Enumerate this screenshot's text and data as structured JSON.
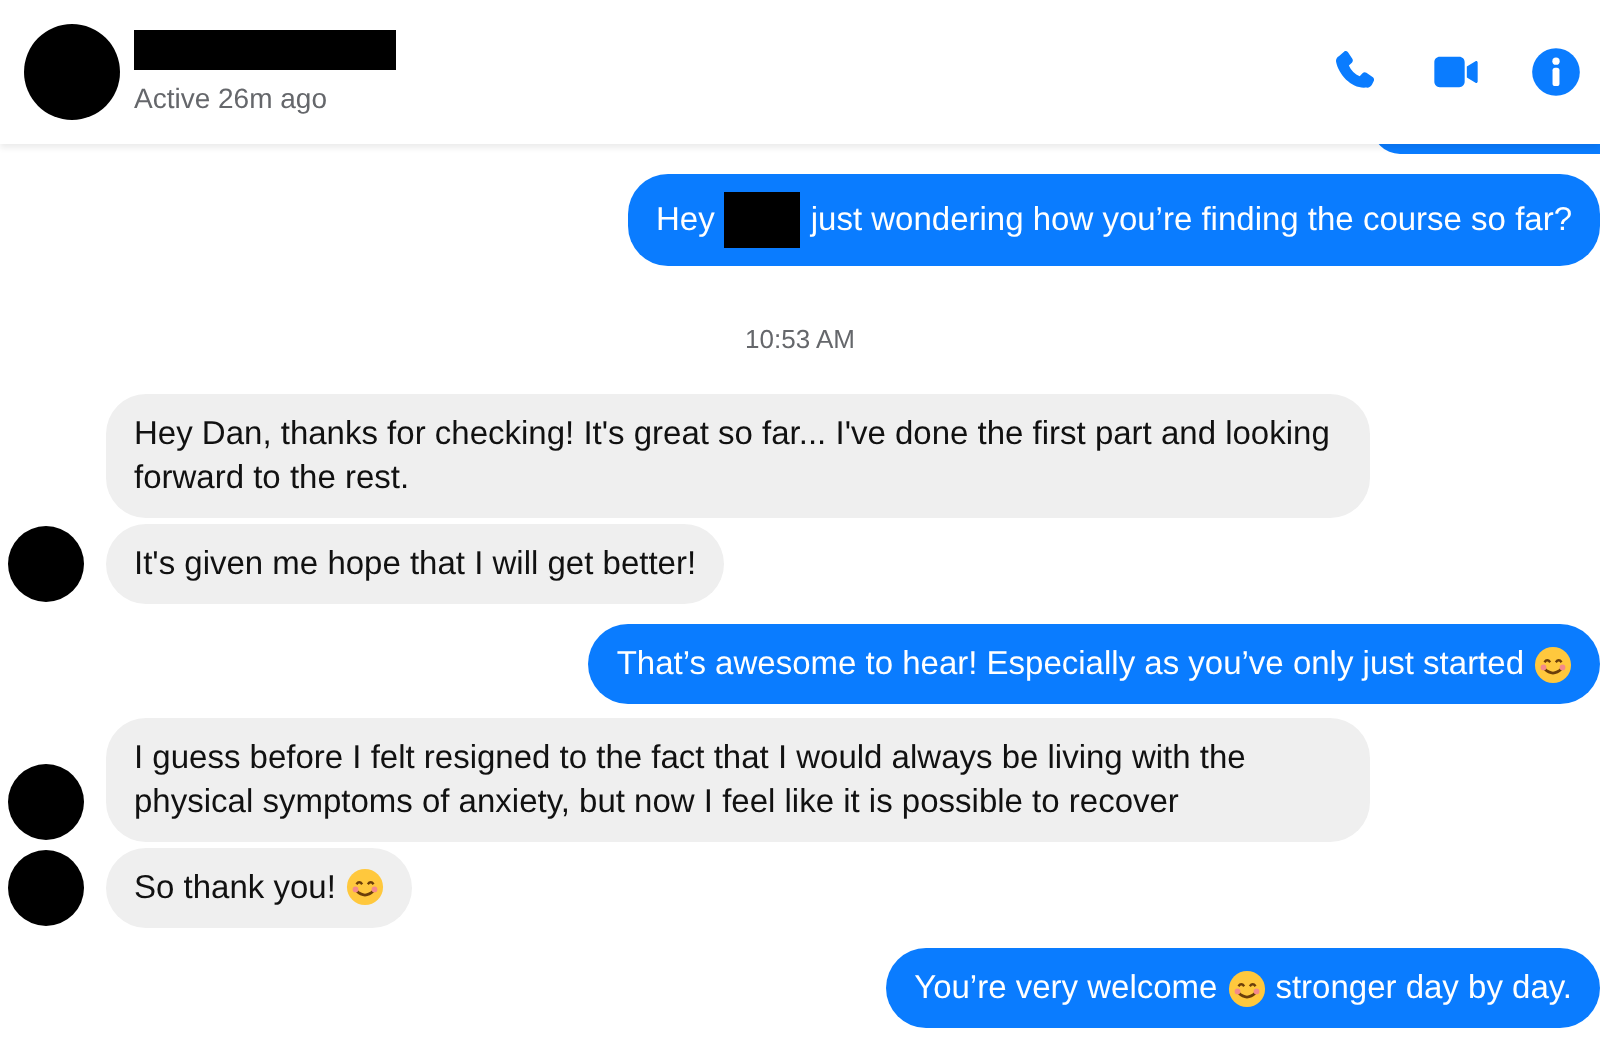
{
  "header": {
    "name_redacted": true,
    "status": "Active 26m ago"
  },
  "messages": [
    {
      "kind": "outgoing",
      "segments": [
        {
          "kind": "text",
          "text": "Hey"
        },
        {
          "kind": "redaction"
        },
        {
          "kind": "text",
          "text": "just wondering how you’re finding the course so far?"
        }
      ]
    },
    {
      "kind": "time",
      "text": "10:53 AM"
    },
    {
      "kind": "incoming",
      "avatar": false,
      "segments": [
        {
          "kind": "text",
          "text": "Hey Dan, thanks for checking!  It's great so far... I've done the first part and looking forward to the rest."
        }
      ]
    },
    {
      "kind": "incoming",
      "avatar": true,
      "segments": [
        {
          "kind": "text",
          "text": "It's given me hope that I will get better!"
        }
      ]
    },
    {
      "kind": "outgoing",
      "segments": [
        {
          "kind": "text",
          "text": "That’s awesome to hear! Especially as you’ve only just started"
        },
        {
          "kind": "emoji"
        }
      ]
    },
    {
      "kind": "incoming",
      "avatar": true,
      "segments": [
        {
          "kind": "text",
          "text": "I guess before I felt resigned to the fact that I would always be living with the physical symptoms of anxiety, but now I feel like it is possible to recover"
        }
      ]
    },
    {
      "kind": "incoming",
      "avatar": true,
      "segments": [
        {
          "kind": "text",
          "text": "So thank you!"
        },
        {
          "kind": "emoji"
        }
      ]
    },
    {
      "kind": "outgoing",
      "segments": [
        {
          "kind": "text",
          "text": "You’re very welcome"
        },
        {
          "kind": "emoji"
        },
        {
          "kind": "text",
          "text": "stronger day by day."
        }
      ]
    }
  ]
}
